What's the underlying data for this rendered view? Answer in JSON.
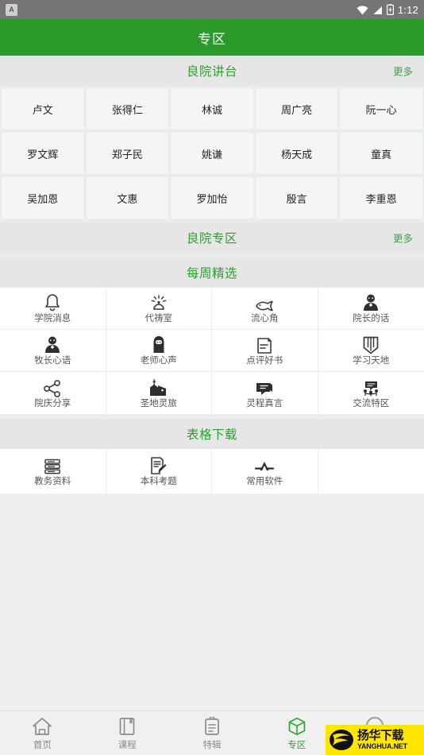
{
  "statusbar": {
    "app_icon": "A",
    "time": "1:12",
    "icons": [
      "wifi-icon",
      "signal-icon",
      "battery-charging-icon"
    ]
  },
  "appbar": {
    "title": "专区"
  },
  "sections": [
    {
      "id": "liangyuan-jiangtai",
      "title": "良院讲台",
      "more_label": "更多",
      "type": "name-cards",
      "names": [
        "卢文",
        "张得仁",
        "林诚",
        "周广亮",
        "阮一心",
        "罗文辉",
        "郑子民",
        "姚谦",
        "杨天成",
        "童真",
        "吴加恩",
        "文惠",
        "罗加怡",
        "殷言",
        "李重恩"
      ]
    },
    {
      "id": "liangyuan-zhuanqu",
      "title": "良院专区",
      "more_label": "更多",
      "type": "header-only"
    },
    {
      "id": "meizhou-jingxuan",
      "title": "每周精选",
      "more_label": "",
      "type": "icon-grid",
      "items": [
        {
          "label": "学院消息",
          "icon": "bell-icon"
        },
        {
          "label": "代祷室",
          "icon": "lamp-icon"
        },
        {
          "label": "流心角",
          "icon": "fish-icon"
        },
        {
          "label": "院长的话",
          "icon": "person-tie-icon"
        },
        {
          "label": "牧长心语",
          "icon": "person-tie-icon"
        },
        {
          "label": "老师心声",
          "icon": "person-veil-icon"
        },
        {
          "label": "点评好书",
          "icon": "document-icon"
        },
        {
          "label": "学习天地",
          "icon": "open-book-icon"
        },
        {
          "label": "院庆分享",
          "icon": "share-icon"
        },
        {
          "label": "圣地灵旅",
          "icon": "church-icon"
        },
        {
          "label": "灵程真言",
          "icon": "speech-bubble-icon"
        },
        {
          "label": "交流特区",
          "icon": "group-chat-icon"
        }
      ]
    },
    {
      "id": "biaoge-xiazai",
      "title": "表格下载",
      "more_label": "",
      "type": "icon-grid",
      "items": [
        {
          "label": "教务资料",
          "icon": "server-list-icon"
        },
        {
          "label": "本科考题",
          "icon": "document-pencil-icon"
        },
        {
          "label": "常用软件",
          "icon": "appstore-icon"
        }
      ]
    }
  ],
  "bottomnav": {
    "items": [
      {
        "label": "首页",
        "icon": "home-icon",
        "active": false
      },
      {
        "label": "课程",
        "icon": "book-icon",
        "active": false
      },
      {
        "label": "特辑",
        "icon": "clipboard-icon",
        "active": false
      },
      {
        "label": "专区",
        "icon": "cube-icon",
        "active": true
      },
      {
        "label": "",
        "icon": "circle-icon",
        "active": false
      }
    ]
  },
  "watermark": {
    "cn": "扬华下载",
    "en": "YANGHUA.NET"
  },
  "colors": {
    "brand_green": "#2a9a2a",
    "section_title_green": "#2ba02b",
    "status_gray": "#757575",
    "card_bg": "#f5f5f5",
    "grid_bg": "#e9ede9",
    "page_bg": "#efefef",
    "watermark_yellow": "#ffe600"
  }
}
